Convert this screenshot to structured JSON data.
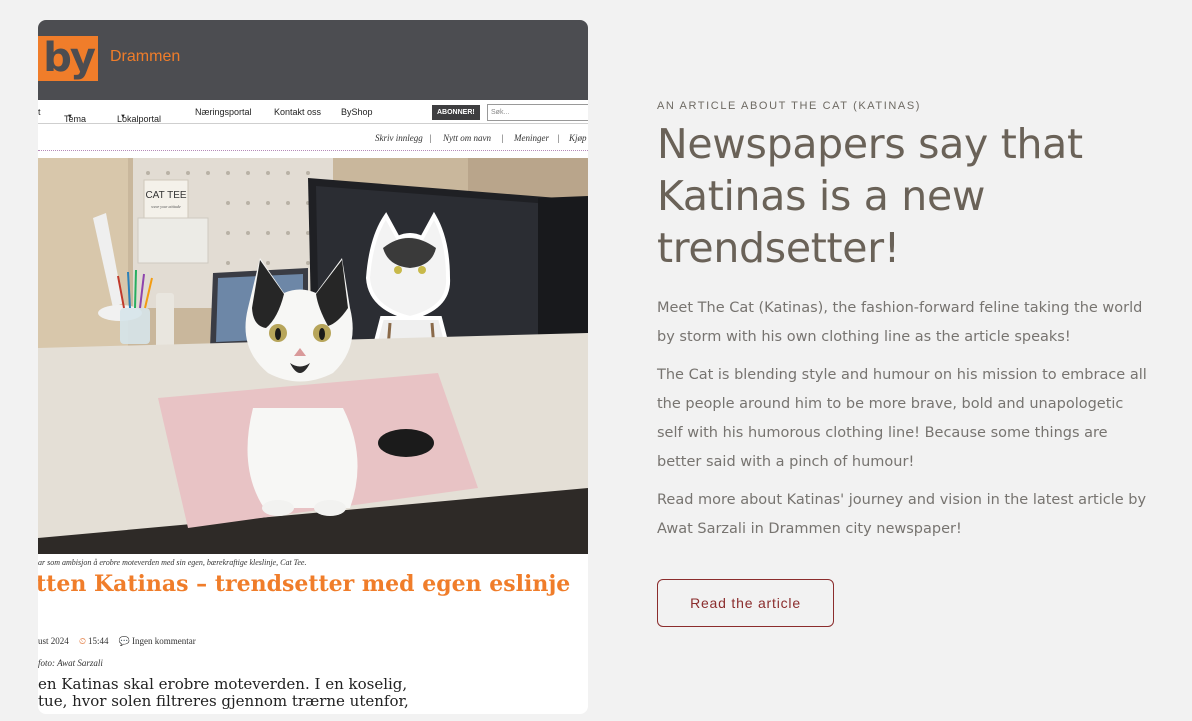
{
  "newspaper": {
    "logo": "by",
    "city": "Drammen",
    "nav": {
      "cut_item": "lt",
      "tema": "Tema",
      "lokalportal": "Lokalportal",
      "naeringsportal": "Næringsportal",
      "kontakt": "Kontakt oss",
      "byshop": "ByShop",
      "subscribe": "ABONNER!",
      "search_placeholder": "Søk..."
    },
    "links": {
      "skriv": "Skriv innlegg",
      "nytt": "Nytt om navn",
      "meninger": "Meninger",
      "kjop": "Kjøp",
      "sep": "|"
    },
    "caption": "ar som ambisjon å erobre moteverden med sin egen, bærekraftige kleslinje, Cat Tee.",
    "headline": "tten Katinas – trendsetter med egen eslinje",
    "date": "ust 2024",
    "time": "15:44",
    "comments": "Ingen kommentar",
    "photo_credit": "foto: Awat Sarzali",
    "body_line1": "en Katinas skal erobre moteverden. I en koselig,",
    "body_line2": "tue, hvor solen filtreres gjennom trærne utenfor,",
    "photo_sign": "CAT TEE",
    "photo_sign_sub": "wear your attitude"
  },
  "article": {
    "eyebrow": "AN ARTICLE ABOUT THE CAT (KATINAS)",
    "title": "Newspapers say that Katinas is a new trendsetter!",
    "paragraphs": [
      "Meet The Cat (Katinas), the fashion-forward feline taking the world by storm with his own clothing line as the article speaks!",
      "The Cat is blending style and humour on his mission to embrace all the people around him to be more brave, bold and unapologetic self with his humorous clothing line! Because some things are better said with a pinch of humour!",
      "Read more about Katinas' journey and vision in the latest article by Awat Sarzali in Drammen city newspaper!"
    ],
    "button_label": "Read the article"
  },
  "colors": {
    "background": "#f2f2f2",
    "title": "#6a6258",
    "body_text": "#777470",
    "button_accent": "#8b2d2d",
    "newspaper_orange": "#f07d2a",
    "newspaper_header": "#4c4d51"
  }
}
